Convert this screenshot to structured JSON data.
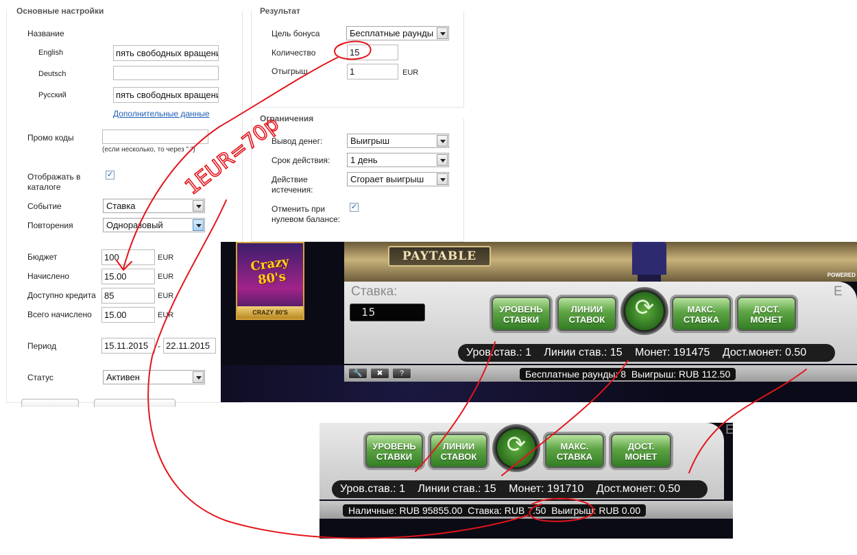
{
  "form": {
    "main_legend": "Основные настройки",
    "name_label": "Название",
    "lang_english": "English",
    "lang_deutsch": "Deutsch",
    "lang_russian": "Русский",
    "name_english_value": "пять свободных вращени",
    "name_deutsch_value": "",
    "name_russian_value": "пять свободных вращени",
    "additional_data_link": "Дополнительные данные",
    "promo_label": "Промо коды",
    "promo_value": "",
    "promo_hint": "(если несколько, то через \",\")",
    "catalog_label": "Отображать в каталоге",
    "catalog_checked": "✓",
    "event_label": "Событие",
    "event_value": "Ставка",
    "repeat_label": "Повторения",
    "repeat_value": "Одноразовый",
    "budget_label": "Бюджет",
    "budget_value": "100",
    "accrued_label": "Начислено",
    "accrued_value": "15.00",
    "available_label": "Доступно кредита",
    "available_value": "85",
    "total_label": "Всего начислено",
    "total_value": "15.00",
    "currency": "EUR",
    "period_label": "Период",
    "period_from": "15.11.2015",
    "period_dash": "-",
    "period_to": "22.11.2015",
    "status_label": "Статус",
    "status_value": "Активен"
  },
  "result": {
    "legend": "Результат",
    "goal_label": "Цель бонуса",
    "goal_value": "Бесплатные раунды",
    "quantity_label": "Количество",
    "quantity_value": "15",
    "wager_label": "Отыгрыш",
    "wager_value": "1",
    "wager_unit": "EUR"
  },
  "limits": {
    "legend": "Ограничения",
    "withdraw_label": "Вывод денег:",
    "withdraw_value": "Выигрыш",
    "validity_label": "Срок действия:",
    "validity_value": "1 день",
    "expiry_label": "Действие истечения:",
    "expiry_value": "Сгорает выигрыш",
    "cancel_label": "Отменить при нулевом балансе:",
    "cancel_checked": "✓"
  },
  "annotation": {
    "handwriting": "1EUR=70p"
  },
  "game1": {
    "logo": "Crazy 80's",
    "logo_caption": "CRAZY 80'S",
    "paytable": "PAYTABLE",
    "powered": "POWERED",
    "stake_label": "Ставка:",
    "stake_digits": "15",
    "btn_level": "УРОВЕНЬ СТАВКИ",
    "btn_lines": "ЛИНИИ СТАВОК",
    "btn_max": "МАКС. СТАВКА",
    "btn_coins": "ДОСТ. МОНЕТ",
    "info_level": "Уров.став.: 1",
    "info_lines": "Линии став.: 15",
    "info_coins": "Монет: 191475",
    "info_coin_value": "Дост.монет: 0.50",
    "status_free": "Бесплатные раунды:  8",
    "status_win": "Выигрыш:  RUB 112.50",
    "right_edge_letter": "E"
  },
  "game2": {
    "btn_level": "УРОВЕНЬ СТАВКИ",
    "btn_lines": "ЛИНИИ СТАВОК",
    "btn_max": "МАКС. СТАВКА",
    "btn_coins": "ДОСТ. МОНЕТ",
    "info_level": "Уров.став.: 1",
    "info_lines": "Линии став.: 15",
    "info_coins": "Монет: 191710",
    "info_coin_value": "Дост.монет: 0.50",
    "status_cash": "Наличные:  RUB 95855.00",
    "status_stake": "Ставка:  RUB 7.50",
    "status_win": "Выигрыш:  RUB 0.00",
    "right_edge_letter": "E"
  },
  "colors": {
    "ink_red": "#e4141b",
    "game_green": "#4e9a38",
    "link_blue": "#1c5fb5"
  }
}
